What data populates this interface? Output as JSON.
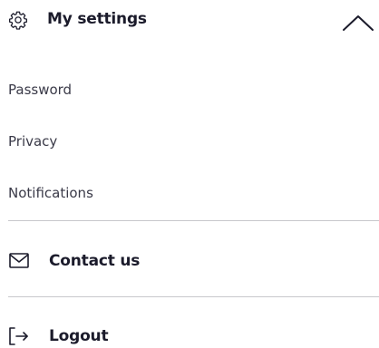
{
  "settings_section": {
    "title": "My settings",
    "header_icon": "gear-icon",
    "toggle_icon": "chevron-up-icon",
    "expanded": true,
    "items": [
      {
        "label": "Password"
      },
      {
        "label": "Privacy"
      },
      {
        "label": "Notifications"
      }
    ]
  },
  "contact": {
    "label": "Contact us",
    "icon": "envelope-icon"
  },
  "logout": {
    "label": "Logout",
    "icon": "logout-icon"
  },
  "colors": {
    "text_primary": "#1b1b2b",
    "text_secondary": "#3a3a48",
    "divider": "#c8c8cc"
  }
}
